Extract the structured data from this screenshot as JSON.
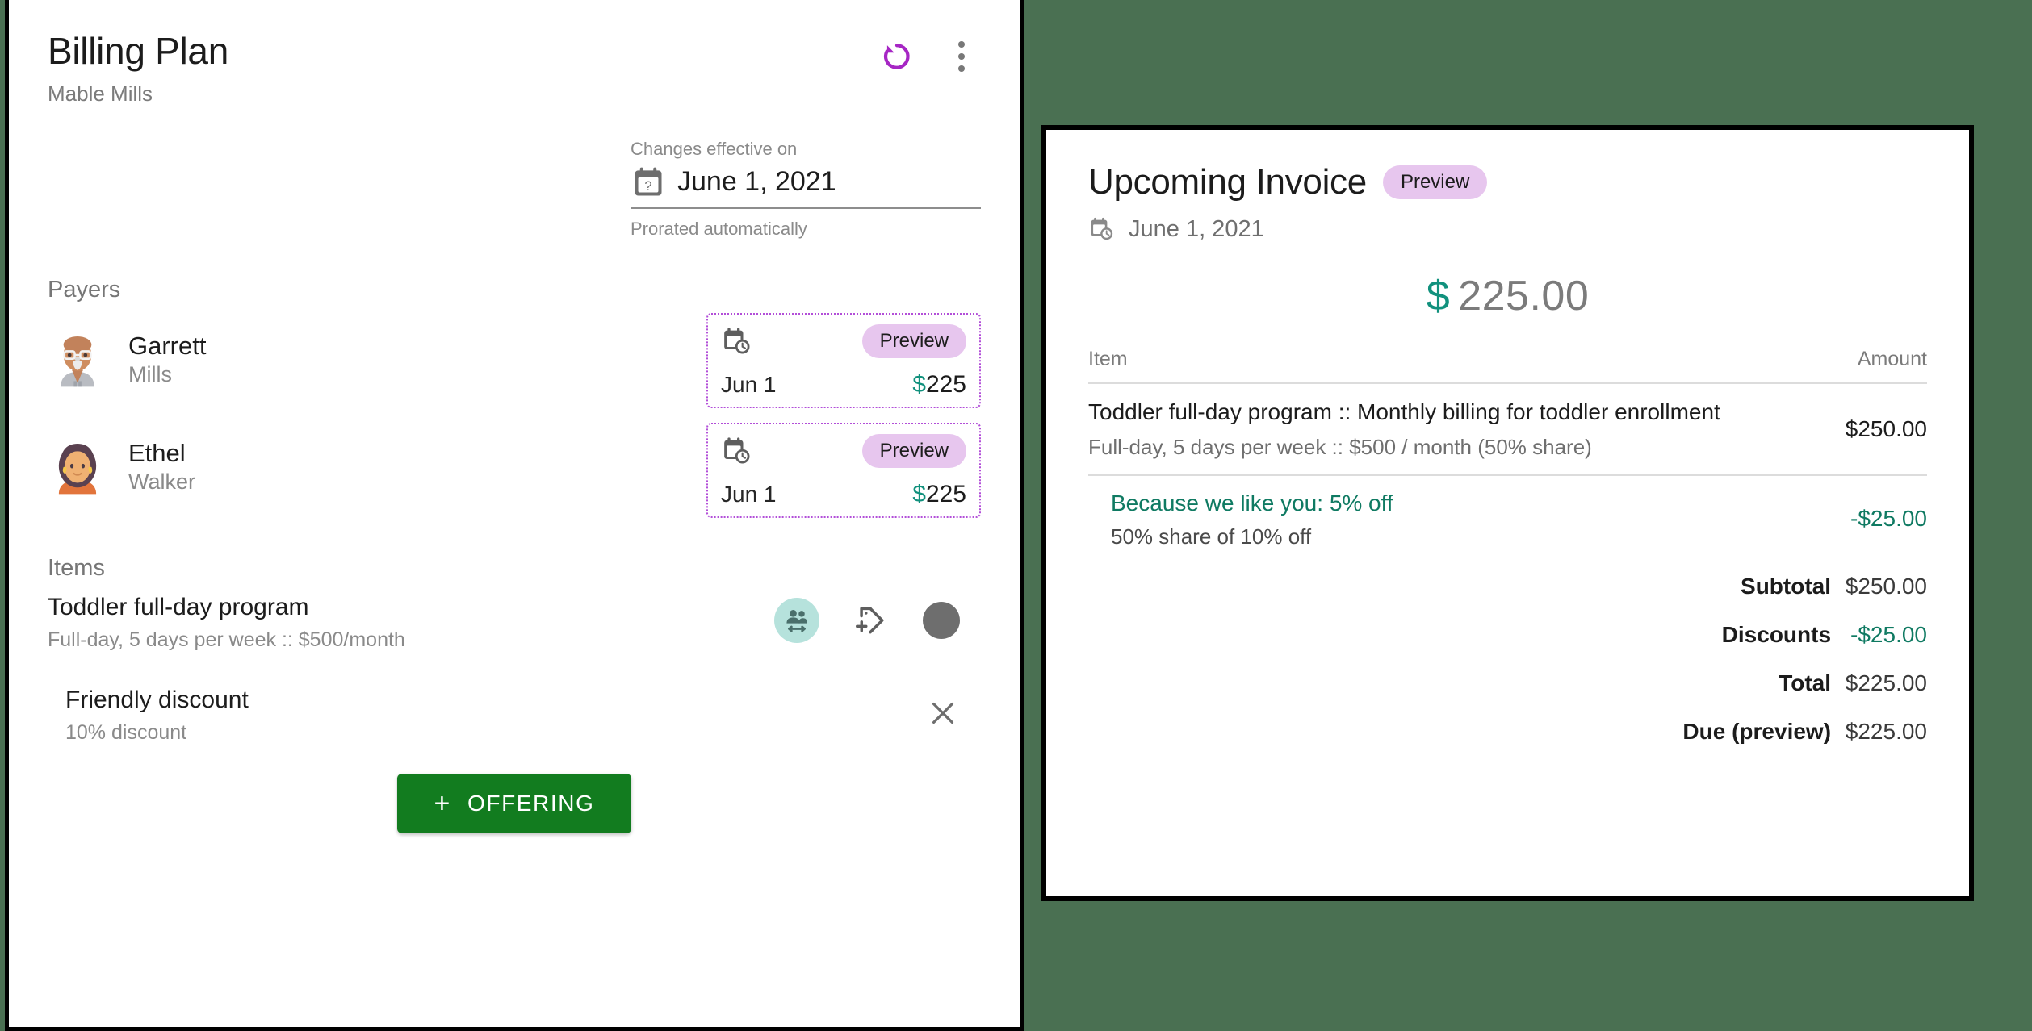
{
  "theme": {
    "background": "#4a7052",
    "accent_purple": "#b24ed8",
    "badge_bg": "#e7c6ee",
    "teal": "#11917d",
    "green_button": "#127c1f",
    "discount_green": "#0f7a62",
    "icon_circle_teal": "#b6e2dc"
  },
  "billing_plan": {
    "title": "Billing Plan",
    "subtitle": "Mable Mills",
    "actions": {
      "restore_label": "restore-icon",
      "menu_label": "more-options-icon"
    },
    "effective": {
      "label": "Changes effective on",
      "date": "June 1, 2021",
      "hint": "Prorated automatically"
    },
    "payers_heading": "Payers",
    "payers": [
      {
        "first_name": "Garrett",
        "last_name": "Mills",
        "avatar": "older-man-with-glasses",
        "badge": "Preview",
        "date": "Jun 1",
        "currency": "$",
        "amount": "225"
      },
      {
        "first_name": "Ethel",
        "last_name": "Walker",
        "avatar": "woman-with-earrings",
        "badge": "Preview",
        "date": "Jun 1",
        "currency": "$",
        "amount": "225"
      }
    ],
    "items_heading": "Items",
    "items": [
      {
        "title": "Toddler full-day program",
        "subtitle": "Full-day, 5 days per week :: $500/month"
      }
    ],
    "discount": {
      "title": "Friendly discount",
      "subtitle": "10% discount"
    },
    "add_button": {
      "plus": "+",
      "label": "OFFERING"
    }
  },
  "invoice": {
    "title": "Upcoming Invoice",
    "badge": "Preview",
    "date": "June 1, 2021",
    "total_currency": "$",
    "total_amount": "225.00",
    "columns": {
      "item": "Item",
      "amount": "Amount"
    },
    "lines": [
      {
        "main": "Toddler full-day program :: Monthly billing for toddler enrollment",
        "sub": "Full-day, 5 days per week :: $500 / month (50% share)",
        "amount": "$250.00"
      }
    ],
    "discount_line": {
      "title": "Because we like you: 5% off",
      "sub": "50% share of 10% off",
      "amount": "-$25.00"
    },
    "totals": [
      {
        "label": "Subtotal",
        "value": "$250.00",
        "green": false
      },
      {
        "label": "Discounts",
        "value": "-$25.00",
        "green": true
      },
      {
        "label": "Total",
        "value": "$225.00",
        "green": false
      },
      {
        "label": "Due (preview)",
        "value": "$225.00",
        "green": false
      }
    ]
  }
}
